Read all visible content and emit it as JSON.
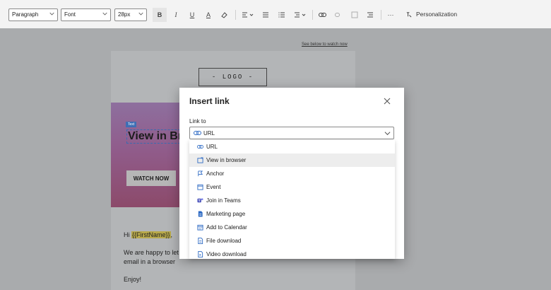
{
  "toolbar": {
    "paragraph": "Paragraph",
    "font": "Font",
    "size": "28px",
    "bold": "B",
    "italic": "I",
    "underline": "U",
    "fontcolor": "A",
    "more": "···",
    "personalization": "Personalization"
  },
  "canvas": {
    "watch_link": "See below to watch now",
    "logo": "- LOGO -",
    "text_tag": "Text",
    "banner_title": "View in Br",
    "watch_button": "WATCH NOW",
    "greeting_prefix": "Hi",
    "greeting_token": "{{FirstName}}",
    "greeting_suffix": ",",
    "body_line1": "We are happy to let",
    "body_line2": "email in a browser",
    "closing": "Enjoy!"
  },
  "dialog": {
    "title": "Insert link",
    "link_to_label": "Link to",
    "link_to_value": "URL",
    "options": [
      {
        "label": "URL",
        "icon": "link-icon"
      },
      {
        "label": "View in browser",
        "icon": "browser-icon"
      },
      {
        "label": "Anchor",
        "icon": "flag-icon"
      },
      {
        "label": "Event",
        "icon": "calendar-icon"
      },
      {
        "label": "Join in Teams",
        "icon": "teams-icon"
      },
      {
        "label": "Marketing page",
        "icon": "page-icon"
      },
      {
        "label": "Add to Calendar",
        "icon": "calendar-add-icon"
      },
      {
        "label": "File download",
        "icon": "file-icon"
      },
      {
        "label": "Video download",
        "icon": "video-file-icon"
      }
    ],
    "selected_index": 1
  },
  "colors": {
    "accent": "#2f6bc4",
    "overlay": "#a9abad"
  }
}
